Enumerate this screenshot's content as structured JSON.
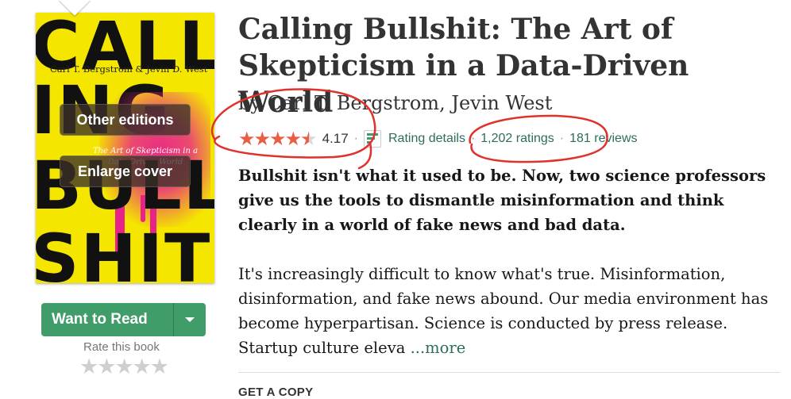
{
  "book": {
    "title": "Calling Bullshit: The Art of Skepticism in a Data-Driven World",
    "by_prefix": "by",
    "authors": [
      "Carl T. Bergstrom",
      "Jevin West"
    ],
    "author_sep": ", ",
    "rating": {
      "stars_value": 4.17,
      "stars_max": 5,
      "average": "4.17",
      "details_label": "Rating details",
      "ratings_count": "1,202 ratings",
      "reviews_count": "181 reviews",
      "separator": "·"
    },
    "description_lead": "Bullshit isn't what it used to be. Now, two science professors give us the tools to dismantle misinformation and think clearly in a world of fake news and bad data.",
    "description_body": "It's increasingly difficult to know what's true. Misinformation, disinformation, and fake news abound. Our media environment has become hyperpartisan. Science is conducted by press release. Startup culture eleva",
    "more_label": "...more",
    "get_copy_label": "GET A COPY"
  },
  "cover": {
    "big_text": [
      "CALL",
      "ING",
      "BULL",
      "SHIT"
    ],
    "authors_text": "Carl T. Bergstrom & Jevin D. West",
    "subtitle_text": "The Art of Skepticism in a Data-Driven World",
    "background_color": "#f5e600",
    "accent_color": "#e7238a",
    "other_editions_label": "Other editions",
    "enlarge_cover_label": "Enlarge cover"
  },
  "shelf": {
    "want_to_read_label": "Want to Read",
    "rate_this_book_label": "Rate this book",
    "rate_stars": [
      "★",
      "★",
      "★",
      "★",
      "★"
    ],
    "button_color": "#409d69"
  },
  "colors": {
    "link": "#2d6d5e",
    "stars": "#e95f46",
    "annotation": "#e0312b"
  },
  "icons": {
    "rating_details": "bar-chart-icon",
    "dropdown": "caret-down-icon"
  }
}
